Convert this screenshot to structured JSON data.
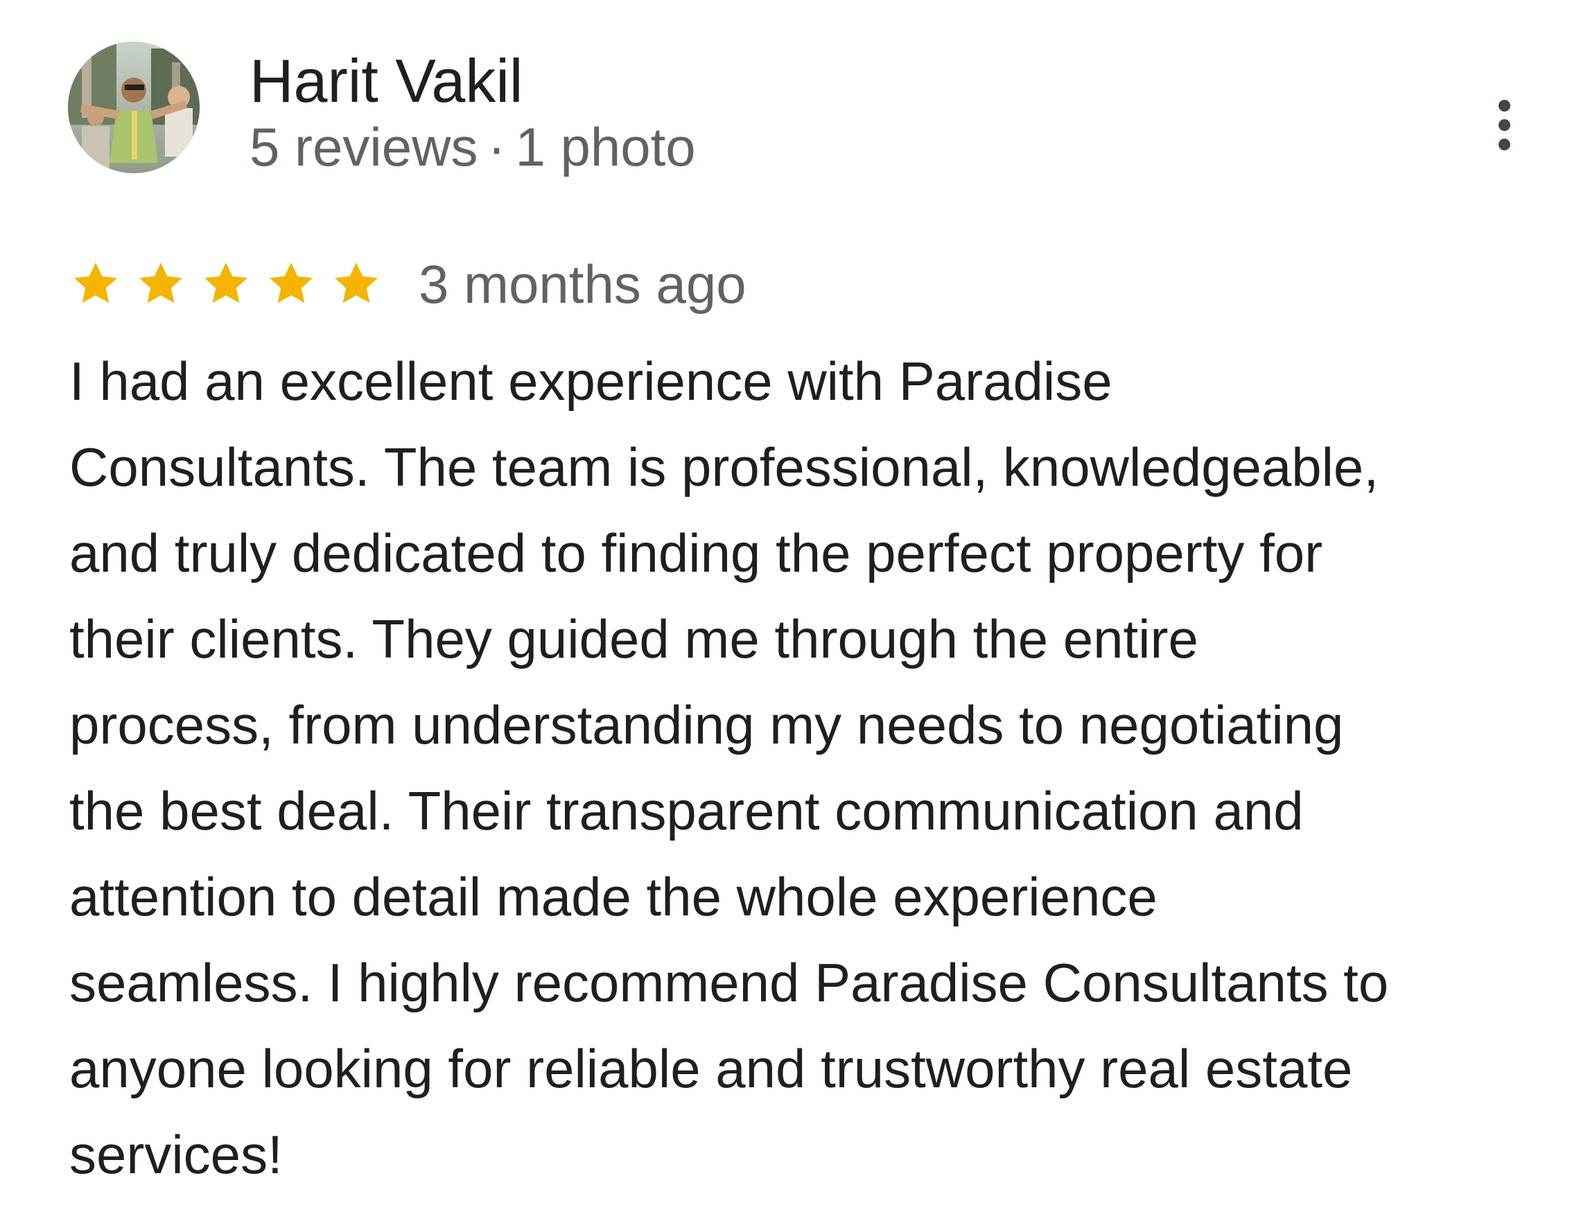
{
  "reviewer": {
    "name": "Harit Vakil",
    "reviews_count": "5 reviews",
    "separator": "·",
    "photos_count": "1 photo"
  },
  "rating": {
    "stars": 5,
    "max_stars": 5,
    "star_color": "#f4b400",
    "date": "3 months ago"
  },
  "review_lines": [
    "I had an excellent experience with Paradise",
    "Consultants. The team is professional, knowledgeable,",
    "and truly dedicated to finding the perfect property for",
    "their clients. They guided me through the entire",
    "process, from understanding my needs to negotiating",
    "the best deal. Their transparent communication and",
    "attention to detail made the whole experience",
    "seamless. I highly recommend Paradise Consultants to",
    "anyone looking for reliable and trustworthy real estate",
    "services!"
  ],
  "icons": {
    "more": "more-vert-icon",
    "star": "star-icon",
    "avatar": "profile-photo"
  }
}
